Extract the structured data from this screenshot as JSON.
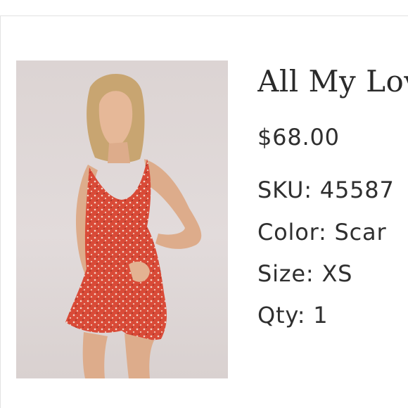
{
  "product": {
    "title": "All My Lov",
    "price": "$68.00",
    "details": {
      "sku": "SKU: 45587",
      "color": "Color: Scar",
      "size": "Size: XS",
      "qty": "Qty: 1"
    }
  },
  "colors": {
    "dress": "#d94a37",
    "background": "#ddd5d4",
    "text": "#2f2f2f"
  }
}
